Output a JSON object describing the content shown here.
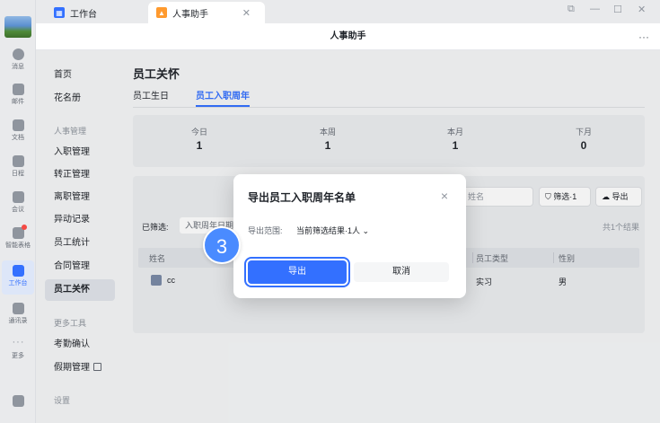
{
  "rail": {
    "items": [
      {
        "label": "消息"
      },
      {
        "label": "邮件"
      },
      {
        "label": "文档"
      },
      {
        "label": "日程"
      },
      {
        "label": "会议"
      },
      {
        "label": "智能表格"
      },
      {
        "label": "工作台"
      },
      {
        "label": "通讯录"
      },
      {
        "label": "更多"
      }
    ]
  },
  "tabs": [
    {
      "label": "工作台"
    },
    {
      "label": "人事助手"
    }
  ],
  "window_controls": {
    "restore": "⧉",
    "minimize": "—",
    "maximize": "☐",
    "close": "✕"
  },
  "titlebar": {
    "title": "人事助手",
    "more": "···"
  },
  "sidenav": {
    "items": [
      {
        "label": "首页"
      },
      {
        "label": "花名册"
      },
      {
        "label": "人事管理"
      },
      {
        "label": "入职管理"
      },
      {
        "label": "转正管理"
      },
      {
        "label": "离职管理"
      },
      {
        "label": "异动记录"
      },
      {
        "label": "员工统计"
      },
      {
        "label": "合同管理"
      },
      {
        "label": "员工关怀"
      },
      {
        "label": "更多工具"
      },
      {
        "label": "考勤确认"
      },
      {
        "label": "假期管理"
      },
      {
        "label": "设置"
      }
    ]
  },
  "main": {
    "title": "员工关怀",
    "subtabs": [
      {
        "label": "员工生日"
      },
      {
        "label": "员工入职周年"
      }
    ],
    "stats": [
      {
        "label": "今日",
        "value": "1"
      },
      {
        "label": "本周",
        "value": "1"
      },
      {
        "label": "本月",
        "value": "1"
      },
      {
        "label": "下月",
        "value": "0"
      }
    ],
    "search_placeholder": "姓名",
    "filter_button": "筛选·1",
    "export_button": "导出",
    "filter_label": "已筛选:",
    "filter_chip": "入职周年日期",
    "result_count": "共1个结果",
    "table": {
      "headers": [
        "姓名",
        "员工类型",
        "性别"
      ],
      "rows": [
        {
          "name": "cc",
          "type": "实习",
          "gender": "男"
        }
      ]
    }
  },
  "modal": {
    "title": "导出员工入职周年名单",
    "close": "×",
    "range_label": "导出范围:",
    "range_value": "当前筛选结果·1人 ⌄",
    "confirm": "导出",
    "cancel": "取消"
  },
  "step_badge": "3",
  "colors": {
    "accent": "#3370ff",
    "badge": "#4a8bff"
  }
}
